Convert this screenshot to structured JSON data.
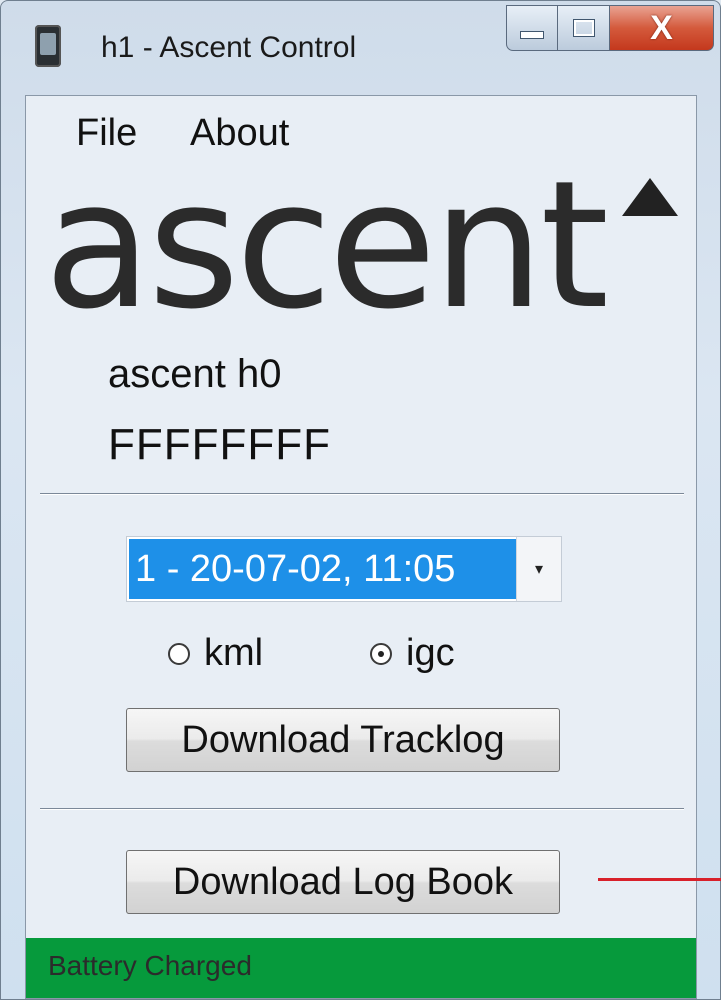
{
  "window": {
    "title": "h1 - Ascent Control",
    "caption_buttons": [
      "minimize",
      "maximize",
      "close"
    ],
    "close_glyph": "X"
  },
  "menu": {
    "file": "File",
    "about": "About"
  },
  "logo": {
    "text": "ascent",
    "mark": "triangle-icon"
  },
  "device": {
    "name": "ascent h0",
    "id": "FFFFFFFF"
  },
  "tracklog": {
    "selected": "1 - 20-07-02, 11:05",
    "format_options": [
      {
        "label": "kml",
        "checked": false
      },
      {
        "label": "igc",
        "checked": true
      }
    ],
    "download_button": "Download Tracklog"
  },
  "logbook": {
    "download_button": "Download Log Book"
  },
  "status": {
    "text": "Battery Charged",
    "color": "#069a3c"
  },
  "colors": {
    "selection": "#1e90e8",
    "annotation": "#d8202a"
  }
}
